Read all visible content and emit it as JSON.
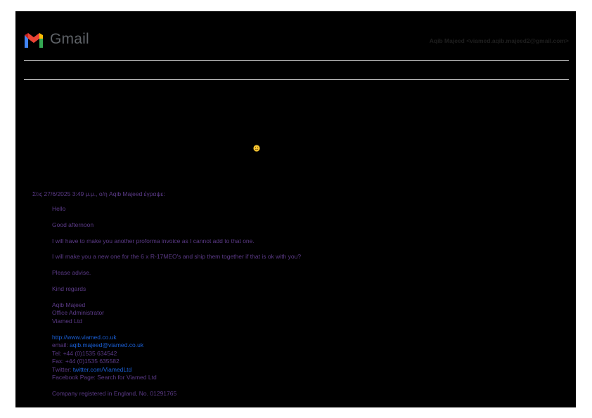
{
  "header": {
    "logo_text": "Gmail",
    "user": "Aqib Majeed <viamed.aqib.majeed2@gmail.com>"
  },
  "quote": {
    "header": "Στις 27/6/2025 3:49 μ.μ., ο/η Aqib Majeed έγραψε:",
    "greeting": "Hello",
    "salutation": "Good afternoon",
    "line1": "I will have to make you another proforma invoice as I cannot add to that one.",
    "line2": "I will make you a new one for the 6 x R-17MEO's and ship them together if that is ok with you?",
    "line3": "Please advise.",
    "closing": "Kind regards",
    "signature": {
      "name": "Aqib Majeed",
      "title": "Office Administrator",
      "company": "Viamed Ltd",
      "website": "http://www.viamed.co.uk",
      "email_label": "email: ",
      "email": "aqib.majeed@viamed.co.uk",
      "tel": "Tel: +44 (0)1535 634542",
      "fax": "Fax: +44 (0)1535 635582",
      "twitter_label": "Twitter: ",
      "twitter": "twitter.com/ViamedLtd",
      "facebook": "Facebook Page: Search for Viamed Ltd",
      "registered": "Company registered in England, No. 01291765"
    }
  },
  "colors": {
    "text": "#5b3a87",
    "link": "#1a5fd6",
    "background": "#000000"
  },
  "icons": {
    "logo": "gmail-logo-icon",
    "emoji": "smiley-emoji-icon"
  }
}
